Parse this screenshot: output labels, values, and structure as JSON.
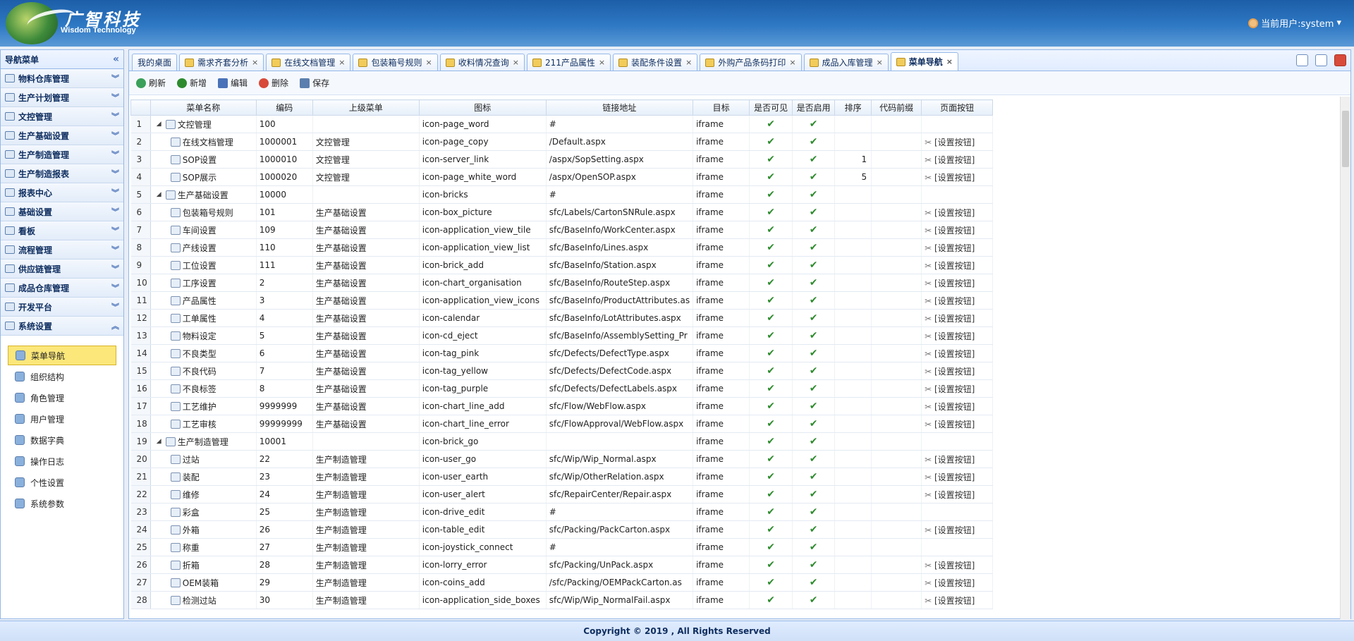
{
  "header": {
    "logo_cn": "广智科技",
    "logo_en": "Wisdom Technology",
    "current_user": "当前用户:system"
  },
  "sidebar": {
    "title": "导航菜单",
    "menus": [
      "物料仓库管理",
      "生产计划管理",
      "文控管理",
      "生产基础设置",
      "生产制造管理",
      "生产制造报表",
      "报表中心",
      "基础设置",
      "看板",
      "流程管理",
      "供应链管理",
      "成品仓库管理",
      "开发平台",
      "系统设置"
    ],
    "sub_items": [
      "菜单导航",
      "组织结构",
      "角色管理",
      "用户管理",
      "数据字典",
      "操作日志",
      "个性设置",
      "系统参数"
    ]
  },
  "tabs": [
    "我的桌面",
    "需求齐套分析",
    "在线文档管理",
    "包装箱号规则",
    "收料情况查询",
    "211产品属性",
    "装配条件设置",
    "外购产品条码打印",
    "成品入库管理",
    "菜单导航"
  ],
  "toolbar": {
    "refresh": "刷新",
    "add": "新增",
    "edit": "编辑",
    "delete": "删除",
    "save": "保存"
  },
  "columns": [
    "菜单名称",
    "编码",
    "上级菜单",
    "图标",
    "链接地址",
    "目标",
    "是否可见",
    "是否启用",
    "排序",
    "代码前缀",
    "页面按钮"
  ],
  "rows": [
    {
      "n": "1",
      "name": "文控管理",
      "code": "100",
      "parent": "",
      "icon": "icon-page_word",
      "url": "#",
      "target": "iframe",
      "vis": "✔",
      "en": "✔",
      "sort": "",
      "prefix": "",
      "btn": "",
      "level": 0
    },
    {
      "n": "2",
      "name": "在线文档管理",
      "code": "1000001",
      "parent": "文控管理",
      "icon": "icon-page_copy",
      "url": "/Default.aspx",
      "target": "iframe",
      "vis": "✔",
      "en": "✔",
      "sort": "",
      "prefix": "",
      "btn": "[设置按钮]",
      "level": 1
    },
    {
      "n": "3",
      "name": "SOP设置",
      "code": "1000010",
      "parent": "文控管理",
      "icon": "icon-server_link",
      "url": "/aspx/SopSetting.aspx",
      "target": "iframe",
      "vis": "✔",
      "en": "✔",
      "sort": "1",
      "prefix": "",
      "btn": "[设置按钮]",
      "level": 1
    },
    {
      "n": "4",
      "name": "SOP展示",
      "code": "1000020",
      "parent": "文控管理",
      "icon": "icon-page_white_word",
      "url": "/aspx/OpenSOP.aspx",
      "target": "iframe",
      "vis": "✔",
      "en": "✔",
      "sort": "5",
      "prefix": "",
      "btn": "[设置按钮]",
      "level": 1
    },
    {
      "n": "5",
      "name": "生产基础设置",
      "code": "10000",
      "parent": "",
      "icon": "icon-bricks",
      "url": "#",
      "target": "iframe",
      "vis": "✔",
      "en": "✔",
      "sort": "",
      "prefix": "",
      "btn": "",
      "level": 0
    },
    {
      "n": "6",
      "name": "包装箱号规则",
      "code": "101",
      "parent": "生产基础设置",
      "icon": "icon-box_picture",
      "url": "sfc/Labels/CartonSNRule.aspx",
      "target": "iframe",
      "vis": "✔",
      "en": "✔",
      "sort": "",
      "prefix": "",
      "btn": "[设置按钮]",
      "level": 1
    },
    {
      "n": "7",
      "name": "车间设置",
      "code": "109",
      "parent": "生产基础设置",
      "icon": "icon-application_view_tile",
      "url": "sfc/BaseInfo/WorkCenter.aspx",
      "target": "iframe",
      "vis": "✔",
      "en": "✔",
      "sort": "",
      "prefix": "",
      "btn": "[设置按钮]",
      "level": 1
    },
    {
      "n": "8",
      "name": "产线设置",
      "code": "110",
      "parent": "生产基础设置",
      "icon": "icon-application_view_list",
      "url": "sfc/BaseInfo/Lines.aspx",
      "target": "iframe",
      "vis": "✔",
      "en": "✔",
      "sort": "",
      "prefix": "",
      "btn": "[设置按钮]",
      "level": 1
    },
    {
      "n": "9",
      "name": "工位设置",
      "code": "111",
      "parent": "生产基础设置",
      "icon": "icon-brick_add",
      "url": "sfc/BaseInfo/Station.aspx",
      "target": "iframe",
      "vis": "✔",
      "en": "✔",
      "sort": "",
      "prefix": "",
      "btn": "[设置按钮]",
      "level": 1
    },
    {
      "n": "10",
      "name": "工序设置",
      "code": "2",
      "parent": "生产基础设置",
      "icon": "icon-chart_organisation",
      "url": "sfc/BaseInfo/RouteStep.aspx",
      "target": "iframe",
      "vis": "✔",
      "en": "✔",
      "sort": "",
      "prefix": "",
      "btn": "[设置按钮]",
      "level": 1
    },
    {
      "n": "11",
      "name": "产品属性",
      "code": "3",
      "parent": "生产基础设置",
      "icon": "icon-application_view_icons",
      "url": "sfc/BaseInfo/ProductAttributes.as",
      "target": "iframe",
      "vis": "✔",
      "en": "✔",
      "sort": "",
      "prefix": "",
      "btn": "[设置按钮]",
      "level": 1
    },
    {
      "n": "12",
      "name": "工单属性",
      "code": "4",
      "parent": "生产基础设置",
      "icon": "icon-calendar",
      "url": "sfc/BaseInfo/LotAttributes.aspx",
      "target": "iframe",
      "vis": "✔",
      "en": "✔",
      "sort": "",
      "prefix": "",
      "btn": "[设置按钮]",
      "level": 1
    },
    {
      "n": "13",
      "name": "物料设定",
      "code": "5",
      "parent": "生产基础设置",
      "icon": "icon-cd_eject",
      "url": "sfc/BaseInfo/AssemblySetting_Pr",
      "target": "iframe",
      "vis": "✔",
      "en": "✔",
      "sort": "",
      "prefix": "",
      "btn": "[设置按钮]",
      "level": 1
    },
    {
      "n": "14",
      "name": "不良类型",
      "code": "6",
      "parent": "生产基础设置",
      "icon": "icon-tag_pink",
      "url": "sfc/Defects/DefectType.aspx",
      "target": "iframe",
      "vis": "✔",
      "en": "✔",
      "sort": "",
      "prefix": "",
      "btn": "[设置按钮]",
      "level": 1
    },
    {
      "n": "15",
      "name": "不良代码",
      "code": "7",
      "parent": "生产基础设置",
      "icon": "icon-tag_yellow",
      "url": "sfc/Defects/DefectCode.aspx",
      "target": "iframe",
      "vis": "✔",
      "en": "✔",
      "sort": "",
      "prefix": "",
      "btn": "[设置按钮]",
      "level": 1
    },
    {
      "n": "16",
      "name": "不良标签",
      "code": "8",
      "parent": "生产基础设置",
      "icon": "icon-tag_purple",
      "url": "sfc/Defects/DefectLabels.aspx",
      "target": "iframe",
      "vis": "✔",
      "en": "✔",
      "sort": "",
      "prefix": "",
      "btn": "[设置按钮]",
      "level": 1
    },
    {
      "n": "17",
      "name": "工艺维护",
      "code": "9999999",
      "parent": "生产基础设置",
      "icon": "icon-chart_line_add",
      "url": "sfc/Flow/WebFlow.aspx",
      "target": "iframe",
      "vis": "✔",
      "en": "✔",
      "sort": "",
      "prefix": "",
      "btn": "[设置按钮]",
      "level": 1
    },
    {
      "n": "18",
      "name": "工艺审核",
      "code": "99999999",
      "parent": "生产基础设置",
      "icon": "icon-chart_line_error",
      "url": "sfc/FlowApproval/WebFlow.aspx",
      "target": "iframe",
      "vis": "✔",
      "en": "✔",
      "sort": "",
      "prefix": "",
      "btn": "[设置按钮]",
      "level": 1
    },
    {
      "n": "19",
      "name": "生产制造管理",
      "code": "10001",
      "parent": "",
      "icon": "icon-brick_go",
      "url": "",
      "target": "iframe",
      "vis": "✔",
      "en": "✔",
      "sort": "",
      "prefix": "",
      "btn": "",
      "level": 0
    },
    {
      "n": "20",
      "name": "过站",
      "code": "22",
      "parent": "生产制造管理",
      "icon": "icon-user_go",
      "url": "sfc/Wip/Wip_Normal.aspx",
      "target": "iframe",
      "vis": "✔",
      "en": "✔",
      "sort": "",
      "prefix": "",
      "btn": "[设置按钮]",
      "level": 1
    },
    {
      "n": "21",
      "name": "装配",
      "code": "23",
      "parent": "生产制造管理",
      "icon": "icon-user_earth",
      "url": "sfc/Wip/OtherRelation.aspx",
      "target": "iframe",
      "vis": "✔",
      "en": "✔",
      "sort": "",
      "prefix": "",
      "btn": "[设置按钮]",
      "level": 1
    },
    {
      "n": "22",
      "name": "维修",
      "code": "24",
      "parent": "生产制造管理",
      "icon": "icon-user_alert",
      "url": "sfc/RepairCenter/Repair.aspx",
      "target": "iframe",
      "vis": "✔",
      "en": "✔",
      "sort": "",
      "prefix": "",
      "btn": "[设置按钮]",
      "level": 1
    },
    {
      "n": "23",
      "name": "彩盒",
      "code": "25",
      "parent": "生产制造管理",
      "icon": "icon-drive_edit",
      "url": "#",
      "target": "iframe",
      "vis": "✔",
      "en": "✔",
      "sort": "",
      "prefix": "",
      "btn": "",
      "level": 1
    },
    {
      "n": "24",
      "name": "外箱",
      "code": "26",
      "parent": "生产制造管理",
      "icon": "icon-table_edit",
      "url": "sfc/Packing/PackCarton.aspx",
      "target": "iframe",
      "vis": "✔",
      "en": "✔",
      "sort": "",
      "prefix": "",
      "btn": "[设置按钮]",
      "level": 1
    },
    {
      "n": "25",
      "name": "称重",
      "code": "27",
      "parent": "生产制造管理",
      "icon": "icon-joystick_connect",
      "url": "#",
      "target": "iframe",
      "vis": "✔",
      "en": "✔",
      "sort": "",
      "prefix": "",
      "btn": "",
      "level": 1
    },
    {
      "n": "26",
      "name": "折箱",
      "code": "28",
      "parent": "生产制造管理",
      "icon": "icon-lorry_error",
      "url": "sfc/Packing/UnPack.aspx",
      "target": "iframe",
      "vis": "✔",
      "en": "✔",
      "sort": "",
      "prefix": "",
      "btn": "[设置按钮]",
      "level": 1
    },
    {
      "n": "27",
      "name": "OEM装箱",
      "code": "29",
      "parent": "生产制造管理",
      "icon": "icon-coins_add",
      "url": "/sfc/Packing/OEMPackCarton.as",
      "target": "iframe",
      "vis": "✔",
      "en": "✔",
      "sort": "",
      "prefix": "",
      "btn": "[设置按钮]",
      "level": 1
    },
    {
      "n": "28",
      "name": "检测过站",
      "code": "30",
      "parent": "生产制造管理",
      "icon": "icon-application_side_boxes",
      "url": "sfc/Wip/Wip_NormalFail.aspx",
      "target": "iframe",
      "vis": "✔",
      "en": "✔",
      "sort": "",
      "prefix": "",
      "btn": "[设置按钮]",
      "level": 1
    }
  ],
  "footer": "Copyright © 2019 , All Rights Reserved"
}
